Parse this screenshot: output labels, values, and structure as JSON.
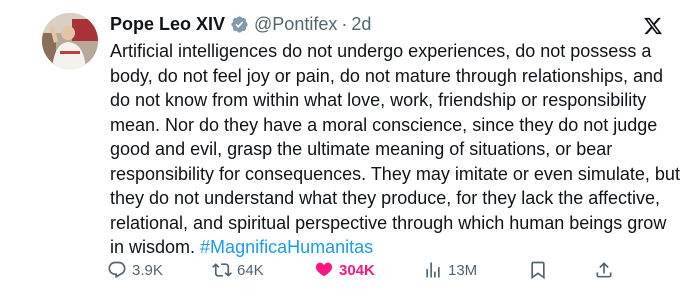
{
  "tweet": {
    "author_name": "Pope Leo XIV",
    "handle": "@Pontifex",
    "separator": "·",
    "time": "2d",
    "text": "Artificial intelligences do not undergo experiences, do not possess a body, do not feel joy or pain, do not mature through relationships, and do not know from within what love, work, friendship or responsibility mean. Nor do they have a moral conscience, since they do not judge good and evil, grasp the ultimate meaning of situations, or bear responsibility for consequences. They may imitate or even simulate, but they do not understand what they produce, for they lack the affective, relational, and spiritual perspective through which human beings grow in wisdom.",
    "hashtag": "#MagnificaHumanitas"
  },
  "actions": {
    "replies": "3.9K",
    "reposts": "64K",
    "likes": "304K",
    "views": "13M"
  },
  "icons": {
    "verified": "verified-badge-icon",
    "x_logo": "x-logo-icon",
    "reply": "reply-icon",
    "repost": "repost-icon",
    "like": "heart-icon",
    "views": "views-icon",
    "bookmark": "bookmark-icon",
    "share": "share-icon"
  },
  "colors": {
    "text": "#0f1419",
    "muted": "#536471",
    "hashtag": "#1d9bf0",
    "like": "#f91880",
    "verified": "#829aab"
  }
}
